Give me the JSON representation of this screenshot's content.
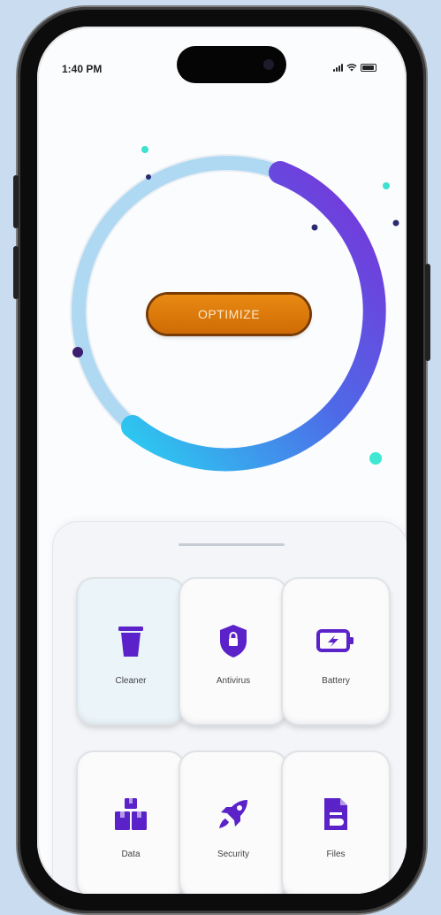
{
  "status_bar": {
    "time": "1:40 PM"
  },
  "main": {
    "optimize_label": "OPTIMIZE"
  },
  "tools": [
    {
      "label": "Cleaner",
      "icon": "trash-icon",
      "active": true
    },
    {
      "label": "Antivirus",
      "icon": "shield-icon",
      "active": false
    },
    {
      "label": "Battery",
      "icon": "battery-icon",
      "active": false
    },
    {
      "label": "Data",
      "icon": "boxes-icon",
      "active": false
    },
    {
      "label": "Security",
      "icon": "rocket-icon",
      "active": false
    },
    {
      "label": "Files",
      "icon": "file-icon",
      "active": false
    }
  ],
  "colors": {
    "accent_purple": "#5a22c8",
    "ring_cyan": "#2ad4f0",
    "button_orange": "#e07a0c"
  }
}
